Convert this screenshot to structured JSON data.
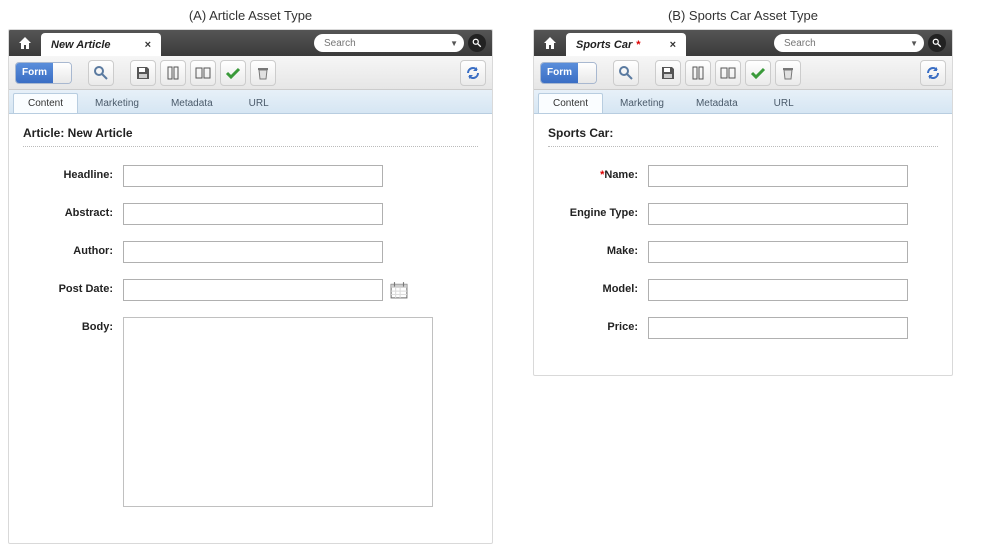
{
  "titles": {
    "left": "(A) Article Asset Type",
    "right": "(B) Sports Car Asset Type"
  },
  "search": {
    "placeholder": "Search"
  },
  "form_button_label": "Form",
  "subtabs": [
    "Content",
    "Marketing",
    "Metadata",
    "URL"
  ],
  "panelA": {
    "tab_title": "New Article",
    "dirty": false,
    "heading": "Article: New Article",
    "fields": {
      "headline": {
        "label": "Headline:",
        "value": ""
      },
      "abstract": {
        "label": "Abstract:",
        "value": ""
      },
      "author": {
        "label": "Author:",
        "value": ""
      },
      "postdate": {
        "label": "Post Date:",
        "value": ""
      },
      "body": {
        "label": "Body:",
        "value": ""
      }
    }
  },
  "panelB": {
    "tab_title": "Sports Car",
    "dirty": true,
    "heading": "Sports Car:",
    "fields": {
      "name": {
        "label": "Name:",
        "value": "",
        "required": true
      },
      "engine": {
        "label": "Engine Type:",
        "value": ""
      },
      "make": {
        "label": "Make:",
        "value": ""
      },
      "model": {
        "label": "Model:",
        "value": ""
      },
      "price": {
        "label": "Price:",
        "value": ""
      }
    }
  }
}
